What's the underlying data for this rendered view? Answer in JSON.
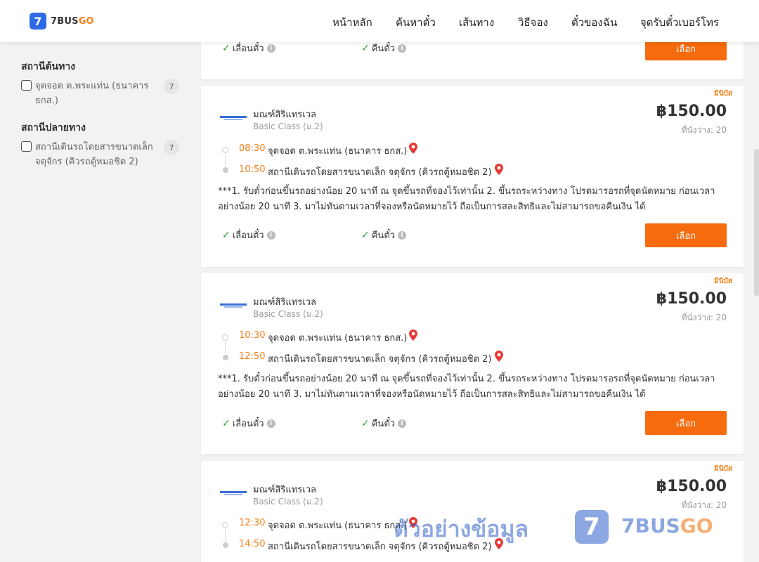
{
  "header": {
    "logo_mark": "7",
    "logo_text_a": "7BUS",
    "logo_text_b": "GO",
    "nav": [
      "หน้าหลัก",
      "ค้นหาตั๋ว",
      "เส้นทาง",
      "วิธีจอง",
      "ตั๋วของฉัน",
      "จุดรับตั๋วเบอร์โทร"
    ]
  },
  "sidebar": {
    "origin_title": "สถานีต้นทาง",
    "origin_option": "จุดจอด ต.พระแท่น (ธนาคาร ธกส.)",
    "origin_count": "7",
    "dest_title": "สถานีปลายทาง",
    "dest_option": "สถานีเดินรถโดยสารขนาดเล็ก จตุจักร (คิวรถตู้หมอชิต 2)",
    "dest_count": "7"
  },
  "top_card": {
    "reschedule": "เลื่อนตั๋ว",
    "refund": "คืนตั๋ว",
    "select": "เลือก"
  },
  "cards": [
    {
      "badge": "มินิบัส",
      "operator": "มณฑ์สิริแทรเวล",
      "class": "Basic Class (ม.2)",
      "price": "฿150.00",
      "seats": "ที่นั่งว่าง: 20",
      "depart_time": "08:30",
      "depart_stop": "จุดจอด ต.พระแท่น (ธนาคาร ธกส.)",
      "arrive_time": "10:50",
      "arrive_stop": "สถานีเดินรถโดยสารขนาดเล็ก จตุจักร (คิวรถตู้หมอชิต 2)",
      "note": "***1. รับตั๋วก่อนขึ้นรถอย่างน้อย 20 นาที ณ จุดขึ้นรถที่จองไว้เท่านั้น 2. ขึ้นรถระหว่างทาง โปรดมารอรถที่จุดนัดหมาย ก่อนเวลาอย่างน้อย 20 นาที 3. มาไม่ทันตามเวลาที่จองหรือนัดหมายไว้ ถือเป็นการสละสิทธิและไม่สามารถขอคืนเงิน ได้",
      "reschedule": "เลื่อนตั๋ว",
      "refund": "คืนตั๋ว",
      "select": "เลือก"
    },
    {
      "badge": "มินิบัส",
      "operator": "มณฑ์สิริแทรเวล",
      "class": "Basic Class (ม.2)",
      "price": "฿150.00",
      "seats": "ที่นั่งว่าง: 20",
      "depart_time": "10:30",
      "depart_stop": "จุดจอด ต.พระแท่น (ธนาคาร ธกส.)",
      "arrive_time": "12:50",
      "arrive_stop": "สถานีเดินรถโดยสารขนาดเล็ก จตุจักร (คิวรถตู้หมอชิต 2)",
      "note": "***1. รับตั๋วก่อนขึ้นรถอย่างน้อย 20 นาที ณ จุดขึ้นรถที่จองไว้เท่านั้น 2. ขึ้นรถระหว่างทาง โปรดมารอรถที่จุดนัดหมาย ก่อนเวลาอย่างน้อย 20 นาที 3. มาไม่ทันตามเวลาที่จองหรือนัดหมายไว้ ถือเป็นการสละสิทธิและไม่สามารถขอคืนเงิน ได้",
      "reschedule": "เลื่อนตั๋ว",
      "refund": "คืนตั๋ว",
      "select": "เลือก"
    },
    {
      "badge": "มินิบัส",
      "operator": "มณฑ์สิริแทรเวล",
      "class": "Basic Class (ม.2)",
      "price": "฿150.00",
      "seats": "ที่นั่งว่าง: 20",
      "depart_time": "12:30",
      "depart_stop": "จุดจอด ต.พระแท่น (ธนาคาร ธกส.)",
      "arrive_time": "14:50",
      "arrive_stop": "สถานีเดินรถโดยสารขนาดเล็ก จตุจักร (คิวรถตู้หมอชิต 2)"
    }
  ],
  "watermark": {
    "text": "ตัวอย่างข้อมูล",
    "logo_mark": "7",
    "brand_a": "7BUS",
    "brand_b": "GO"
  },
  "colors": {
    "accent": "#f66b0e",
    "brand_blue": "#2c6ae6",
    "time": "#f57f17"
  }
}
